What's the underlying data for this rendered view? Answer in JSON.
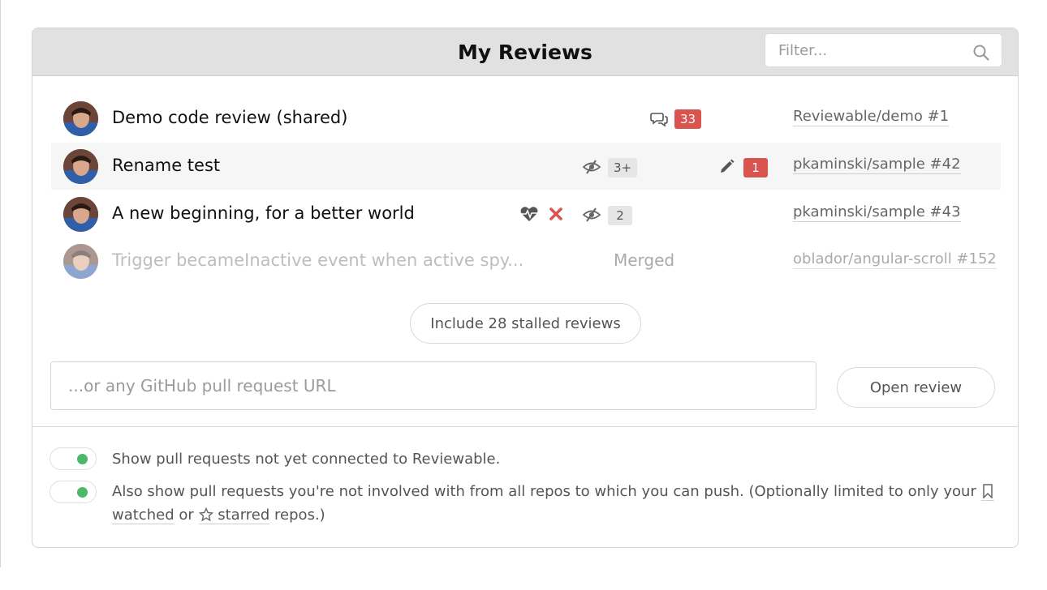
{
  "header": {
    "title": "My Reviews",
    "filter_placeholder": "Filter..."
  },
  "reviews": [
    {
      "title": "Demo code review (shared)",
      "comment_count": "33",
      "repo": "Reviewable/demo #1"
    },
    {
      "title": "Rename test",
      "unreviewed_files": "3+",
      "drafts": "1",
      "repo": "pkaminski/sample #42"
    },
    {
      "title": "A new beginning, for a better world",
      "unreviewed_files": "2",
      "repo": "pkaminski/sample #43"
    },
    {
      "title": "Trigger becameInactive event when active spy...",
      "status": "Merged",
      "repo": "oblador/angular-scroll #152"
    }
  ],
  "stalled_button": "Include 28 stalled reviews",
  "url_input_placeholder": "...or any GitHub pull request URL",
  "open_review_button": "Open review",
  "options": {
    "option1": "Show pull requests not yet connected to Reviewable.",
    "option2_part1": "Also show pull requests you're not involved with from all repos to which you can push. (Optionally limited to only your",
    "option2_watched": "watched",
    "option2_or": "or",
    "option2_starred": "starred",
    "option2_end": "repos.)"
  },
  "colors": {
    "badge_red": "#d9534f",
    "toggle_on": "#4cb86a",
    "header_bg": "#e1e1e1"
  }
}
